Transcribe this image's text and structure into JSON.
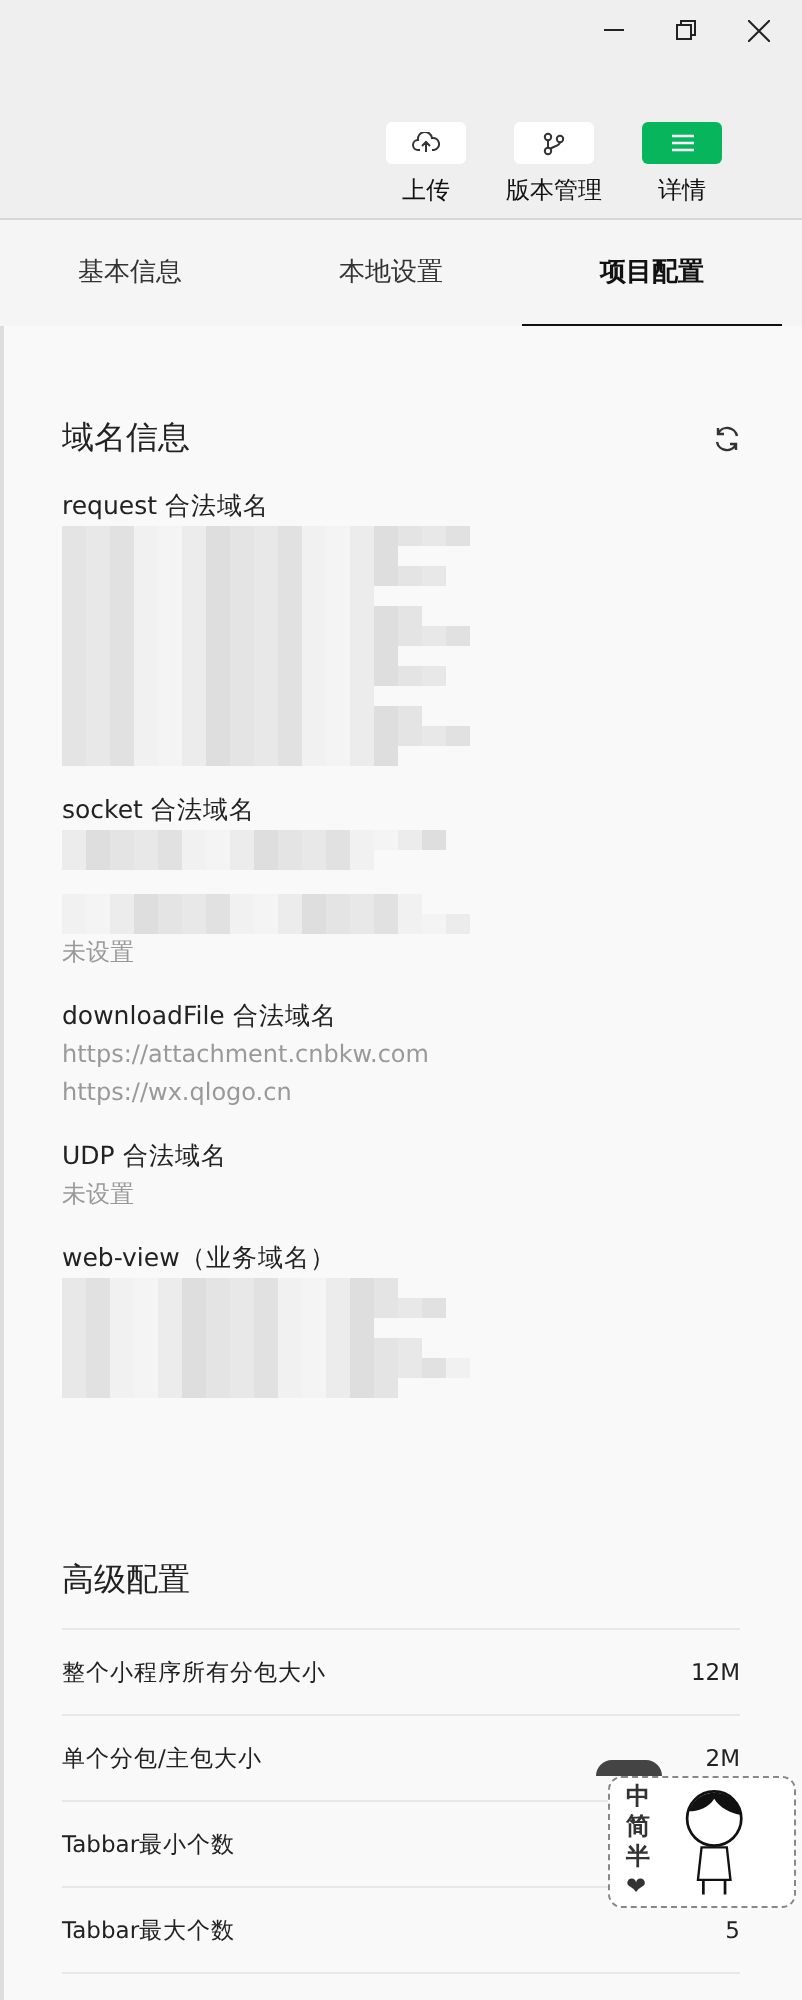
{
  "toolbar": {
    "buttons": [
      {
        "kind": "upload",
        "label": "上传",
        "primary": false
      },
      {
        "kind": "version",
        "label": "版本管理",
        "primary": false
      },
      {
        "kind": "detail",
        "label": "详情",
        "primary": true
      }
    ]
  },
  "tabs": [
    {
      "label": "基本信息",
      "selected": false
    },
    {
      "label": "本地设置",
      "selected": false
    },
    {
      "label": "项目配置",
      "selected": true
    }
  ],
  "domain_section": {
    "title": "域名信息",
    "items": [
      {
        "label": "request 合法域名",
        "kind": "redacted"
      },
      {
        "label": "socket 合法域名",
        "kind": "redacted"
      },
      {
        "values": [
          "未设置"
        ],
        "kind": "redacted"
      },
      {
        "label": "downloadFile 合法域名",
        "values": [
          "https://attachment.cnbkw.com",
          "https://wx.qlogo.cn"
        ]
      },
      {
        "label": "UDP 合法域名",
        "values": [
          "未设置"
        ]
      },
      {
        "label": "web-view（业务域名）",
        "kind": "redacted"
      }
    ]
  },
  "advanced_section": {
    "title": "高级配置",
    "rows": [
      {
        "label": "整个小程序所有分包大小",
        "value": "12M"
      },
      {
        "label": "单个分包/主包大小",
        "value": "2M"
      },
      {
        "label": "Tabbar最小个数"
      },
      {
        "label": "Tabbar最大个数",
        "value": "5"
      }
    ]
  },
  "ime_widget": {
    "chars": [
      "中",
      "简",
      "半",
      "❤"
    ]
  }
}
